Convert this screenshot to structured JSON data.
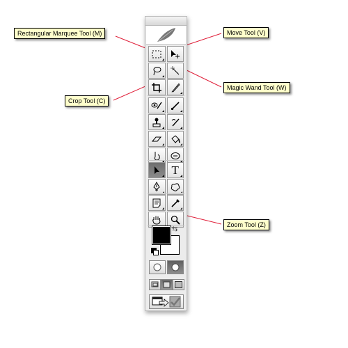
{
  "tooltips": [
    {
      "id": "marquee",
      "label": "Rectangular Marquee Tool (M)"
    },
    {
      "id": "move",
      "label": "Move Tool (V)"
    },
    {
      "id": "magic-wand",
      "label": "Magic Wand Tool (W)"
    },
    {
      "id": "crop",
      "label": "Crop Tool (C)"
    },
    {
      "id": "zoom",
      "label": "Zoom Tool (Z)"
    }
  ],
  "palette": {
    "logo_icon": "feather-icon",
    "tools": [
      {
        "left": "rectangular-marquee-tool",
        "right": "move-tool"
      },
      {
        "left": "lasso-tool",
        "right": "magic-wand-tool"
      },
      {
        "left": "crop-tool",
        "right": "slice-tool"
      },
      {
        "left": "healing-brush-tool",
        "right": "brush-tool"
      },
      {
        "left": "clone-stamp-tool",
        "right": "history-brush-tool"
      },
      {
        "left": "eraser-tool",
        "right": "paint-bucket-tool"
      },
      {
        "left": "blur-tool",
        "right": "dodge-tool"
      },
      {
        "left": "path-selection-tool",
        "right": "type-tool"
      },
      {
        "left": "pen-tool",
        "right": "custom-shape-tool"
      },
      {
        "left": "notes-tool",
        "right": "eyedropper-tool"
      },
      {
        "left": "hand-tool",
        "right": "zoom-tool"
      }
    ],
    "type_glyph": "T",
    "selected_tool": "path-selection-tool",
    "foreground_color": "#000000",
    "background_color": "#ffffff",
    "swap_glyph": "⇆",
    "accent_line_color": "#e0203a",
    "tooltip_bg": "#ffffcc"
  }
}
